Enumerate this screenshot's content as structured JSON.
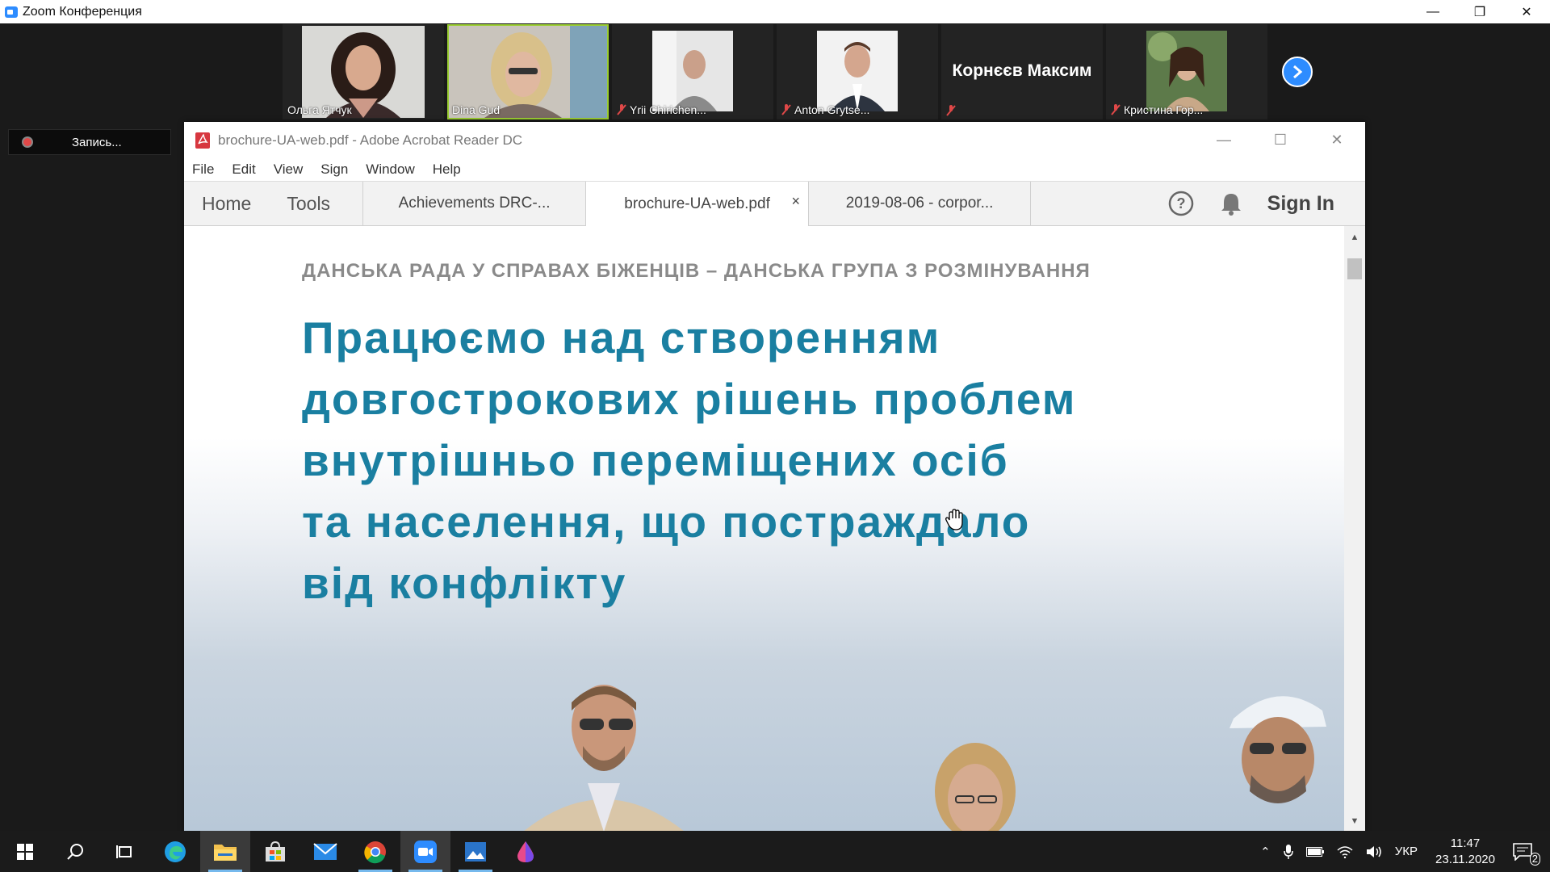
{
  "zoom": {
    "window_title": "Zoom Конференция",
    "recording_label": "Запись...",
    "participants": [
      {
        "name": "Ольга Ятчук"
      },
      {
        "name": "Dina Gud"
      },
      {
        "name": "Yrii Chirichen..."
      },
      {
        "name": "Anton Grytse..."
      },
      {
        "name": "Корнєєв Максим"
      },
      {
        "name": "Кристина Гор..."
      }
    ]
  },
  "acrobat": {
    "window_title": "brochure-UA-web.pdf - Adobe Acrobat Reader DC",
    "menu": [
      "File",
      "Edit",
      "View",
      "Sign",
      "Window",
      "Help"
    ],
    "nav": {
      "home": "Home",
      "tools": "Tools"
    },
    "tabs": [
      {
        "label": "Achievements DRC-..."
      },
      {
        "label": "brochure-UA-web.pdf",
        "close": "×"
      },
      {
        "label": "2019-08-06 - corpor..."
      }
    ],
    "sign_in": "Sign In"
  },
  "document": {
    "header": "ДАНСЬКА РАДА У СПРАВАХ БІЖЕНЦІВ – ДАНСЬКА ГРУПА З РОЗМІНУВАННЯ",
    "headline_lines": [
      "Працюємо над створенням",
      "довгострокових рішень проблем",
      "внутрішньо переміщених осіб",
      "та населення, що постраждало",
      "від конфлікту"
    ]
  },
  "taskbar": {
    "language": "УКР",
    "time": "11:47",
    "date": "23.11.2020",
    "notification_count": "2"
  },
  "colors": {
    "headline": "#1a7fa1",
    "zoom_blue": "#2d8cff",
    "active_speaker": "#9acd32"
  }
}
